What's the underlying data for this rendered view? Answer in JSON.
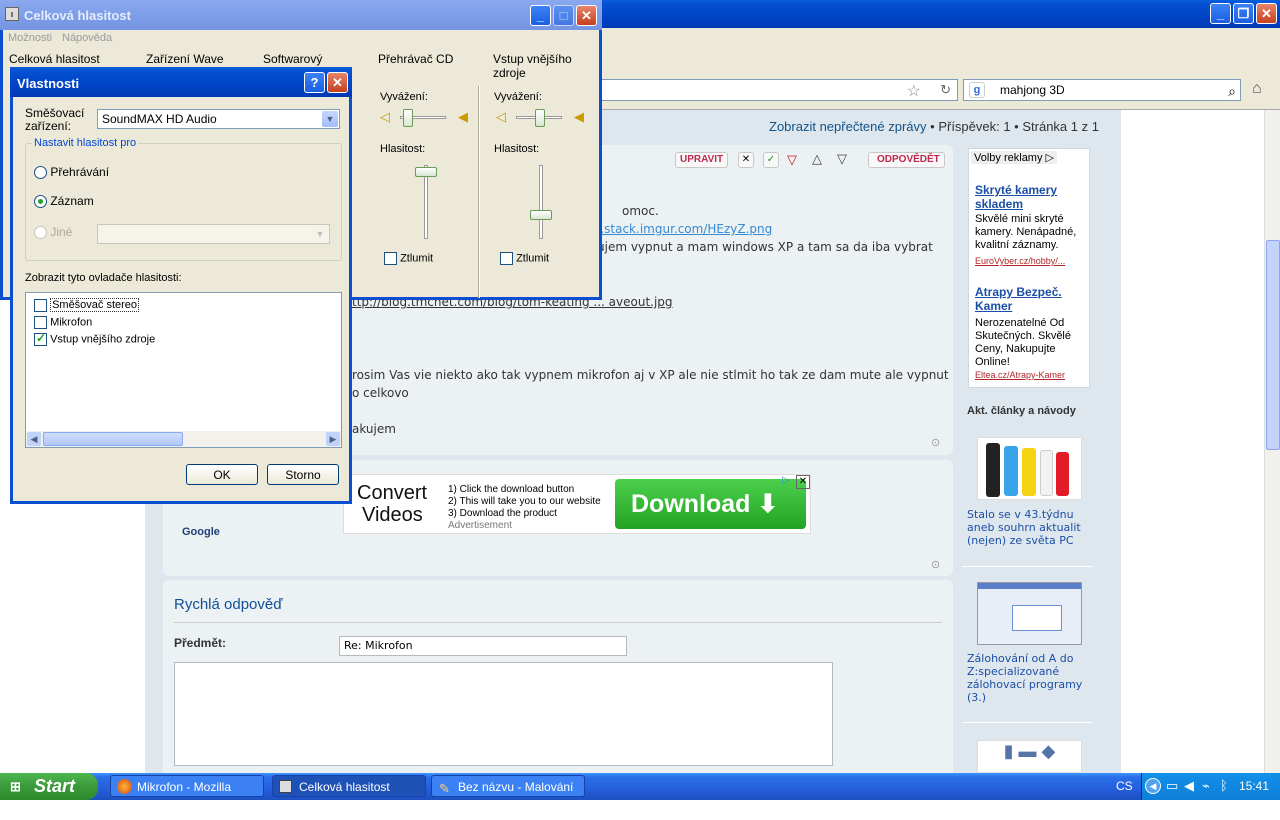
{
  "browser": {
    "title": "Mikrofon - Mozilla Firefox",
    "search_value": "mahjong 3D"
  },
  "forum": {
    "unread_link": "Zobrazit nepřečtené zprávy",
    "post_count": "• Příspěvek: 1 • Stránka 1 z 1",
    "buttons": {
      "edit": "UPRAVIT",
      "reply": "ODPOVĚDĚT"
    },
    "post_lines": [
      "omoc.",
      "i.stack.imgur.com/HEzyZ.png",
      "ujem vypnut a mam windows XP a tam sa da iba vybrat",
      "ttp://blog.tmcnet.com/blog/tom-keating ... aveout.jpg",
      "rosim Vas vie niekto ako tak vypnem mikrofon aj v XP ale nie stlmit ho tak ze dam mute ale vypnut",
      "o celkovo",
      "akujem"
    ],
    "google_label": "Google",
    "ad": {
      "convert": "Convert",
      "videos": "Videos",
      "steps": [
        "1) Click the download button",
        "2) This will take you to our website",
        "3) Download the product"
      ],
      "advertisement": "Advertisement",
      "download": "Download"
    },
    "quick_reply": {
      "title": "Rychlá odpověď",
      "subject_label": "Předmět:",
      "subject_value": "Re: Mikrofon"
    }
  },
  "sidebar": {
    "ad_choice": "Volby reklamy",
    "ads": [
      {
        "title": "Skryté kamery skladem",
        "body": "Skvělé mini skryté kamery. Nenápadné, kvalitní záznamy.",
        "url": "EuroVyber.cz/hobby/..."
      },
      {
        "title": "Atrapy Bezpeč. Kamer",
        "body": "Nerozenatelné Od Skutečných. Skvělé Ceny, Nakupujte Online!",
        "url": "Eltea.cz/Atrapy-Kamer"
      }
    ],
    "articles_title": "Akt. články a návody",
    "articles": [
      "Stalo se v 43.týdnu aneb souhrn aktualit (nejen) ze světa PC",
      "Zálohování od A do Z:specializované zálohovací programy (3.)"
    ]
  },
  "volume_window": {
    "title": "Celková hlasitost",
    "menu": [
      "Možnosti",
      "Nápověda"
    ],
    "channels": [
      "Celková hlasitost",
      "Zařízení Wave",
      "Softwarový",
      "Přehrávač CD",
      "Vstup vnějšího zdroje"
    ],
    "balance_label": "Vyvážení:",
    "volume_label": "Hlasitost:",
    "mute_label": "Ztlumit"
  },
  "dialog": {
    "title": "Vlastnosti",
    "mixer_label_1": "Směšovací",
    "mixer_label_2": "zařízení:",
    "mixer_value": "SoundMAX HD Audio",
    "group_title": "Nastavit hlasitost pro",
    "radio_playback": "Přehrávání",
    "radio_record": "Záznam",
    "radio_other": "Jiné",
    "list_label": "Zobrazit tyto ovladače hlasitosti:",
    "list_items": [
      {
        "label": "Směšovač stereo",
        "checked": false
      },
      {
        "label": "Mikrofon",
        "checked": false
      },
      {
        "label": "Vstup vnějšího zdroje",
        "checked": true
      }
    ],
    "ok": "OK",
    "cancel": "Storno"
  },
  "taskbar": {
    "start": "Start",
    "tasks": [
      "Mikrofon - Mozilla Fire...",
      "Celková hlasitost",
      "Bez názvu - Malování"
    ],
    "lang": "CS",
    "clock": "15:41"
  }
}
